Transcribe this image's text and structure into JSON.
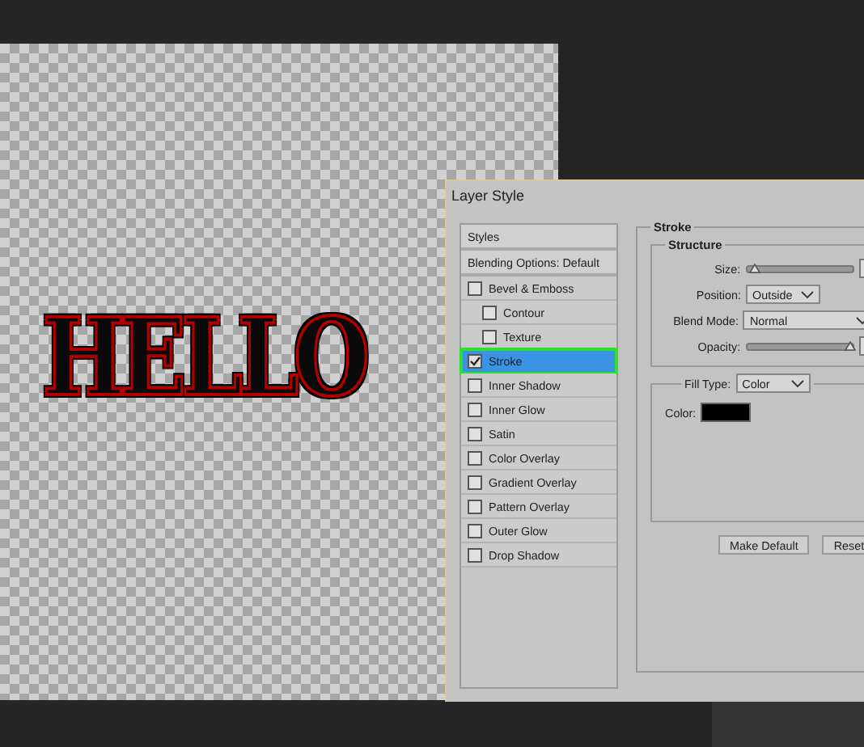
{
  "canvas": {
    "text": "HELLO"
  },
  "dialog": {
    "title": "Layer Style",
    "style_list": [
      {
        "label": "Styles",
        "kind": "header"
      },
      {
        "label": "Blending Options: Default",
        "kind": "header"
      },
      {
        "label": "Bevel & Emboss",
        "kind": "check",
        "checked": false,
        "selected": false
      },
      {
        "label": "Contour",
        "kind": "subcheck",
        "checked": false,
        "selected": false
      },
      {
        "label": "Texture",
        "kind": "subcheck",
        "checked": false,
        "selected": false
      },
      {
        "label": "Stroke",
        "kind": "check",
        "checked": true,
        "selected": true
      },
      {
        "label": "Inner Shadow",
        "kind": "check",
        "checked": false,
        "selected": false
      },
      {
        "label": "Inner Glow",
        "kind": "check",
        "checked": false,
        "selected": false
      },
      {
        "label": "Satin",
        "kind": "check",
        "checked": false,
        "selected": false
      },
      {
        "label": "Color Overlay",
        "kind": "check",
        "checked": false,
        "selected": false
      },
      {
        "label": "Gradient Overlay",
        "kind": "check",
        "checked": false,
        "selected": false
      },
      {
        "label": "Pattern Overlay",
        "kind": "check",
        "checked": false,
        "selected": false
      },
      {
        "label": "Outer Glow",
        "kind": "check",
        "checked": false,
        "selected": false
      },
      {
        "label": "Drop Shadow",
        "kind": "check",
        "checked": false,
        "selected": false
      }
    ],
    "stroke": {
      "title": "Stroke",
      "structure": {
        "title": "Structure",
        "size": {
          "label": "Size:",
          "level": 0.06
        },
        "position": {
          "label": "Position:",
          "value": "Outside"
        },
        "blend_mode": {
          "label": "Blend Mode:",
          "value": "Normal"
        },
        "opacity": {
          "label": "Opacity:",
          "level": 0.97
        }
      },
      "fill_type": {
        "label": "Fill Type:",
        "value": "Color"
      },
      "color": {
        "label": "Color:",
        "color": "#000000"
      }
    },
    "buttons": [
      "Make Default",
      "Reset"
    ]
  }
}
